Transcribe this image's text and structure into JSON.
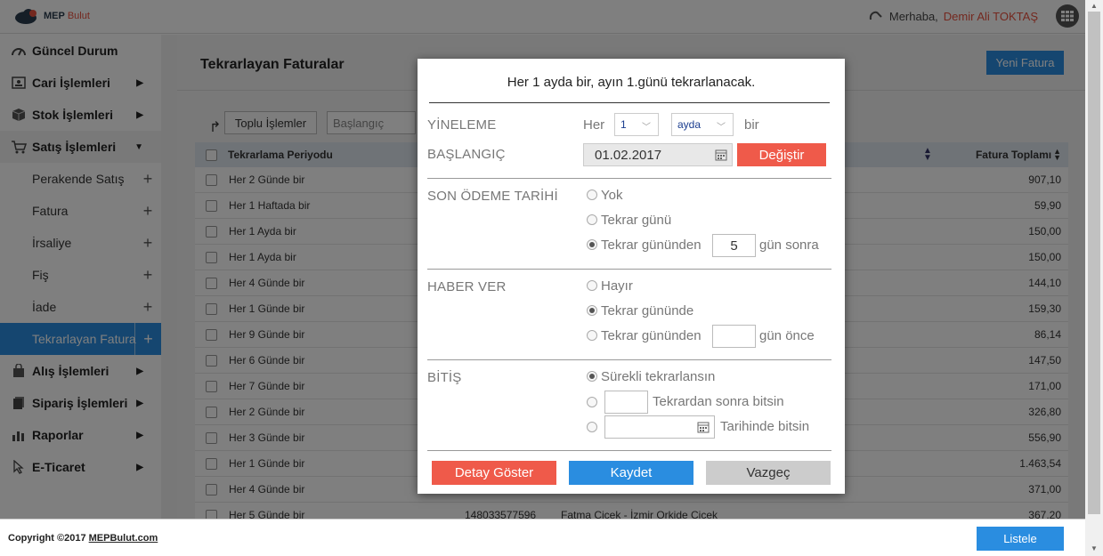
{
  "header": {
    "logo_mep": "MEP",
    "logo_bulut": "Bulut",
    "greeting": "Merhaba,",
    "user_name": "Demir Ali TOKTAŞ"
  },
  "sidebar": {
    "items": [
      {
        "label": "Güncel Durum",
        "icon": "dashboard-icon"
      },
      {
        "label": "Cari İşlemleri",
        "icon": "contact-card-icon"
      },
      {
        "label": "Stok İşlemleri",
        "icon": "box-icon"
      },
      {
        "label": "Satış İşlemleri",
        "icon": "cart-icon"
      },
      {
        "label": "Alış İşlemleri",
        "icon": "shopping-bag-icon"
      },
      {
        "label": "Sipariş İşlemleri",
        "icon": "documents-icon"
      },
      {
        "label": "Raporlar",
        "icon": "bar-chart-icon"
      },
      {
        "label": "E-Ticaret",
        "icon": "cursor-icon"
      }
    ],
    "sub_items": [
      {
        "label": "Perakende Satış"
      },
      {
        "label": "Fatura"
      },
      {
        "label": "İrsaliye"
      },
      {
        "label": "Fiş"
      },
      {
        "label": "İade"
      },
      {
        "label": "Tekrarlayan Fatura"
      }
    ]
  },
  "main": {
    "title": "Tekrarlayan Faturalar",
    "new_button": "Yeni Fatura",
    "bulk_button": "Toplu İşlemler",
    "start_placeholder": "Başlangıç",
    "columns": {
      "period": "Tekrarlama Periyodu",
      "total": "Fatura Toplamı"
    },
    "rows": [
      {
        "period": "Her 2 Günde bir",
        "doc": "",
        "customer": "",
        "total": "907,10"
      },
      {
        "period": "Her 1 Haftada bir",
        "doc": "",
        "customer": "",
        "total": "59,90"
      },
      {
        "period": "Her 1 Ayda bir",
        "doc": "",
        "customer": "",
        "total": "150,00"
      },
      {
        "period": "Her 1 Ayda bir",
        "doc": "",
        "customer": "",
        "total": "150,00"
      },
      {
        "period": "Her 4 Günde bir",
        "doc": "",
        "customer": "",
        "total": "144,10"
      },
      {
        "period": "Her 1 Günde bir",
        "doc": "",
        "customer": "",
        "total": "159,30"
      },
      {
        "period": "Her 9 Günde bir",
        "doc": "",
        "customer": "",
        "total": "86,14"
      },
      {
        "period": "Her 6 Günde bir",
        "doc": "",
        "customer": "",
        "total": "147,50"
      },
      {
        "period": "Her 7 Günde bir",
        "doc": "",
        "customer": "",
        "total": "171,00"
      },
      {
        "period": "Her 2 Günde bir",
        "doc": "",
        "customer": "",
        "total": "326,80"
      },
      {
        "period": "Her 3 Günde bir",
        "doc": "",
        "customer": "",
        "total": "556,90"
      },
      {
        "period": "Her 1 Günde bir",
        "doc": "",
        "customer": "",
        "total": "1.463,54"
      },
      {
        "period": "Her 4 Günde bir",
        "doc": "",
        "customer": "",
        "total": "371,00"
      },
      {
        "period": "Her 5 Günde bir",
        "doc": "148033577596",
        "customer": "Fatma Cicek - İzmir Orkide Cicek",
        "total": "367,20"
      }
    ]
  },
  "footer": {
    "copyright_prefix": "Copyright ©2017 ",
    "copyright_link": "MEPBulut.com",
    "list_button": "Listele"
  },
  "modal": {
    "summary": "Her 1 ayda bir, ayın 1.günü tekrarlanacak.",
    "repeat": {
      "label": "YİNELEME",
      "prefix": "Her",
      "count_value": "1",
      "unit_value": "ayda",
      "suffix": "bir"
    },
    "start": {
      "label": "BAŞLANGIÇ",
      "date": "01.02.2017",
      "change_button": "Değiştir"
    },
    "due": {
      "label": "SON ÖDEME TARİHİ",
      "options": [
        "Yok",
        "Tekrar günü",
        "Tekrar gününden"
      ],
      "days_value": "5",
      "days_suffix": "gün sonra",
      "selected_index": 2
    },
    "notify": {
      "label": "HABER VER",
      "options": [
        "Hayır",
        "Tekrar gününde",
        "Tekrar gününden"
      ],
      "days_value": "",
      "days_suffix": "gün önce",
      "selected_index": 1
    },
    "end": {
      "label": "BİTİŞ",
      "options": [
        "Sürekli tekrarlansın",
        "Tekrardan sonra bitsin",
        "Tarihinde bitsin"
      ],
      "count_value": "",
      "date_value": "",
      "selected_index": 0
    },
    "buttons": {
      "detail": "Detay Göster",
      "save": "Kaydet",
      "cancel": "Vazgeç"
    }
  },
  "colors": {
    "accent": "#2a8de0",
    "danger": "#ef5a4a",
    "user_name": "#e8513e"
  }
}
